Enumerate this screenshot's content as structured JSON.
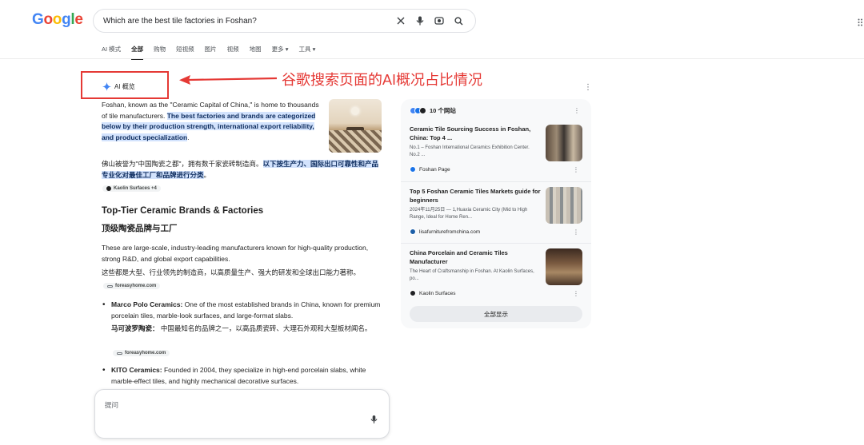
{
  "header": {
    "logo": "Google",
    "query": "Which are the best tile factories in Foshan?"
  },
  "tabs": [
    "AI 模式",
    "全部",
    "购物",
    "短视频",
    "图片",
    "视频",
    "地图",
    "更多 ▾",
    "工具 ▾"
  ],
  "ai_overview": {
    "label": "AI 概览",
    "annotation": "谷歌搜索页面的AI概况占比情况",
    "intro_en_plain": "Foshan, known as the \"Ceramic Capital of China,\" is home to thousands of tile manufacturers. ",
    "intro_en_hl": "The best factories and brands are categorized below by their production strength, international export reliability, and product specialization",
    "intro_en_end": ".",
    "intro_zh_plain": "佛山被誉为\"中国陶瓷之都\"，拥有数千家瓷砖制造商。",
    "intro_zh_hl": "以下按生产力、国际出口可靠性和产品专业化对最佳工厂和品牌进行分类",
    "intro_zh_end": "。",
    "chip1": "Kaolin Surfaces +4",
    "heading_en": "Top-Tier Ceramic Brands & Factories",
    "heading_zh": "顶级陶瓷品牌与工厂",
    "para_en": "These are large-scale, industry-leading manufacturers known for high-quality production, strong R&D, and global export capabilities.",
    "para_zh": "这些都是大型、行业领先的制造商，以高质量生产、强大的研发和全球出口能力著称。",
    "chip2": "foreasyhome.com",
    "bullets": [
      {
        "name": "Marco Polo Ceramics:",
        "text": " One of the most established brands in China, known for premium porcelain tiles, marble-look surfaces, and large-format slabs.",
        "name_zh": "马可波罗陶瓷：",
        "text_zh": " 中国最知名的品牌之一，以高品质瓷砖、大理石外观和大型板材闻名。",
        "chip": "foreasyhome.com"
      },
      {
        "name": "KITO Ceramics:",
        "text": " Founded in 2004, they specialize in high-end porcelain slabs, white marble-effect tiles, and highly mechanical decorative surfaces."
      }
    ]
  },
  "prompt": {
    "placeholder": "提问"
  },
  "sources_panel": {
    "header": "10 个网站",
    "show_all": "全部显示",
    "cards": [
      {
        "title": "Ceramic Tile Sourcing Success in Foshan, China: Top 4 ...",
        "snippet": "No.1 – Foshan International Ceramics Exhibition Center. No.2 ...",
        "source": "Foshan Page"
      },
      {
        "title": "Top 5 Foshan Ceramic Tiles Markets guide for beginners",
        "snippet": "2024年11月25日 — 1,Huaxia Ceramic City (Mid to High Range, Ideal for Home Ren...",
        "source": "lisafurniturefromchina.com"
      },
      {
        "title": "China Porcelain and Ceramic Tiles Manufacturer",
        "snippet": "The Heart of Craftsmanship in Foshan. At Kaolin Surfaces, po...",
        "source": "Kaolin Surfaces"
      }
    ]
  }
}
